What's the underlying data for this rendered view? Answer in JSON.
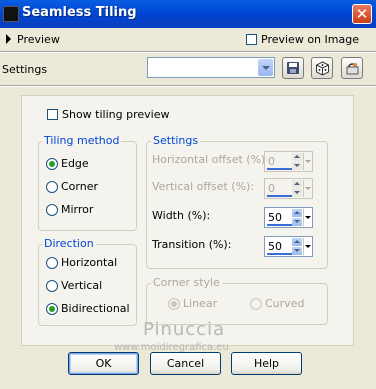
{
  "window": {
    "title": "Seamless Tiling",
    "close_glyph": "✕"
  },
  "preview": {
    "label": "Preview",
    "preview_on_image_label": "Preview on Image",
    "preview_on_image_checked": false
  },
  "settings_row": {
    "label": "Settings",
    "preset_value": ""
  },
  "show_tiling_preview": {
    "label": "Show tiling preview",
    "checked": false
  },
  "tiling_method": {
    "title": "Tiling method",
    "options": [
      {
        "label": "Edge",
        "checked": true
      },
      {
        "label": "Corner",
        "checked": false
      },
      {
        "label": "Mirror",
        "checked": false
      }
    ]
  },
  "direction": {
    "title": "Direction",
    "options": [
      {
        "label": "Horizontal",
        "checked": false
      },
      {
        "label": "Vertical",
        "checked": false
      },
      {
        "label": "Bidirectional",
        "checked": true
      }
    ]
  },
  "settings": {
    "title": "Settings",
    "horizontal_offset": {
      "label": "Horizontal offset (%):",
      "value": "0",
      "enabled": false
    },
    "vertical_offset": {
      "label": "Vertical offset (%):",
      "value": "0",
      "enabled": false
    },
    "width": {
      "label": "Width (%):",
      "value": "50",
      "enabled": true
    },
    "transition": {
      "label": "Transition (%):",
      "value": "50",
      "enabled": true
    }
  },
  "corner_style": {
    "title": "Corner style",
    "options": [
      {
        "label": "Linear",
        "checked": true,
        "enabled": false
      },
      {
        "label": "Curved",
        "checked": false,
        "enabled": false
      }
    ]
  },
  "watermark": {
    "line1": "Pinuccia",
    "line2": "www.moidiregrafica.eu"
  },
  "buttons": {
    "ok": "OK",
    "cancel": "Cancel",
    "help": "Help"
  },
  "colors": {
    "titlebar": "#0a5ee0",
    "group_title": "#0046d5",
    "radio_dot": "#21a121",
    "disabled_text": "#aca899"
  },
  "icons": [
    "app-icon",
    "close-icon",
    "expand-arrow-icon",
    "save-preset-icon",
    "randomize-icon",
    "reset-icon"
  ]
}
